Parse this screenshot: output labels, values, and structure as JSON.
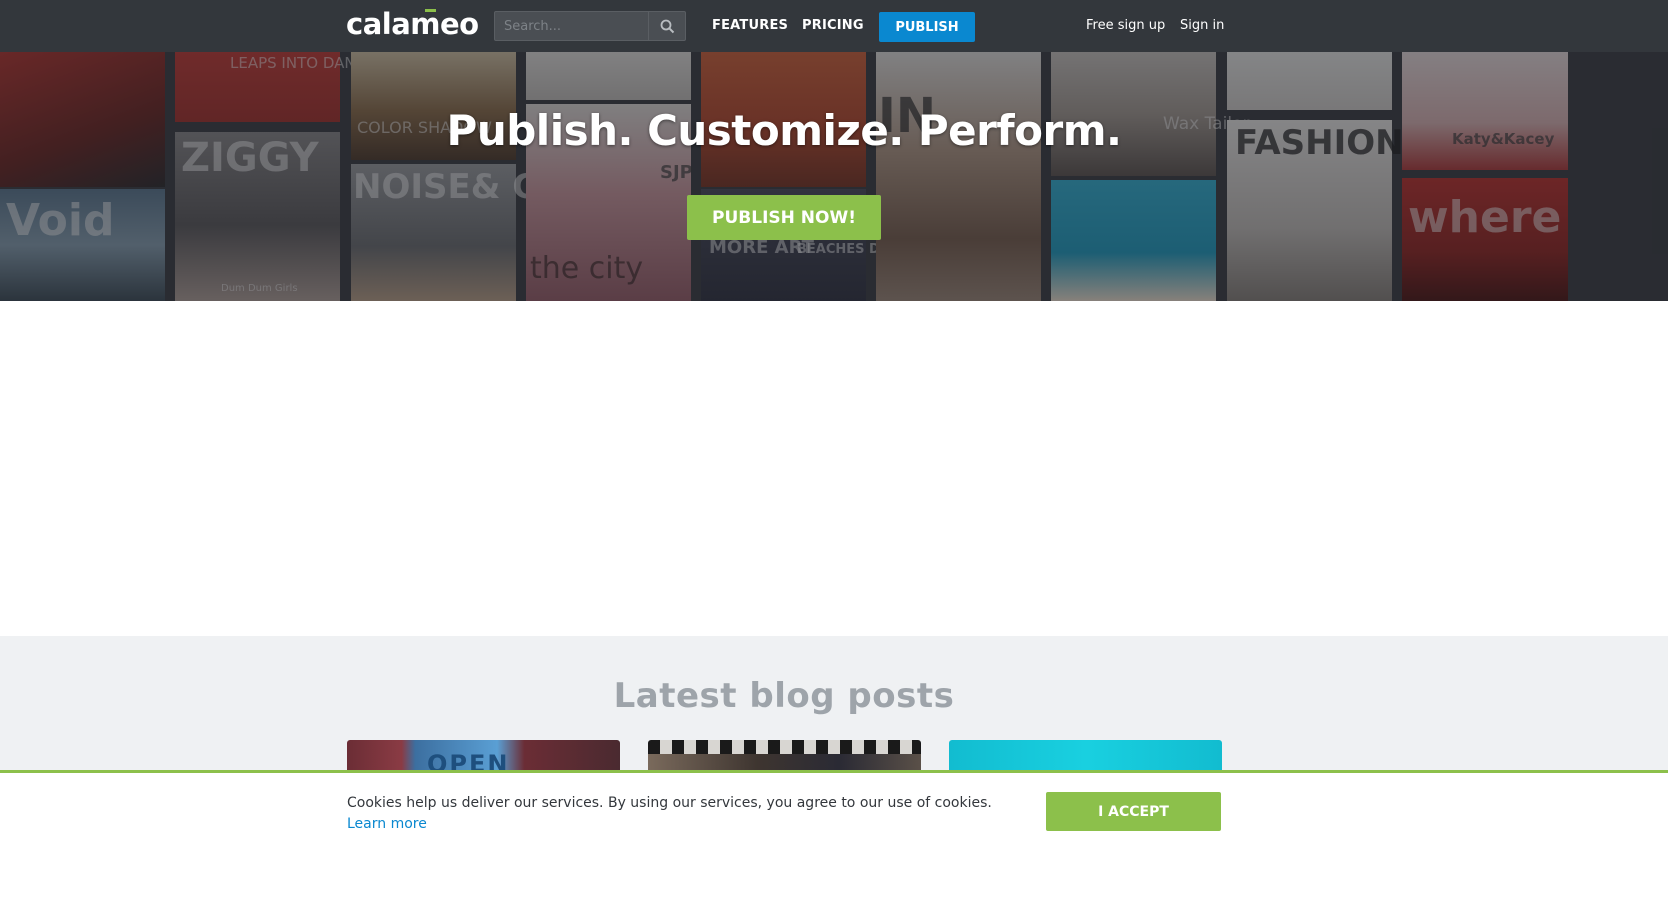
{
  "header": {
    "logo_text": "calameo",
    "search_placeholder": "Search...",
    "search_icon": "magnifier-icon",
    "nav_features": "FEATURES",
    "nav_pricing": "PRICING",
    "publish_label": "PUBLISH",
    "signup_label": "Free sign up",
    "signin_label": "Sign in"
  },
  "hero": {
    "title": "Publish. Customize. Perform.",
    "cta_label": "PUBLISH NOW!",
    "cover_texts": [
      "LEAPS INTO DANCE",
      "ZIGGY",
      "Void",
      "NOISE& COLOR",
      "SJP",
      "IN",
      "Wax Tailor",
      "FASHION",
      "where",
      "Katy&Kacey",
      "Dum Dum Girls",
      "the city",
      "BEACHES DOWNTOWN",
      "MORE ART",
      "COLOR SHADOW"
    ]
  },
  "blog": {
    "title": "Latest blog posts",
    "card_thumb_text": "OPEN"
  },
  "cookie": {
    "message": "Cookies help us deliver our services. By using our services, you agree to our use of cookies.",
    "learn_more": "Learn more",
    "accept_label": "I ACCEPT"
  },
  "colors": {
    "header_bg": "#33373c",
    "accent_blue": "#0a88d0",
    "accent_green": "#8cc04b",
    "blog_bg": "#eff1f3"
  }
}
